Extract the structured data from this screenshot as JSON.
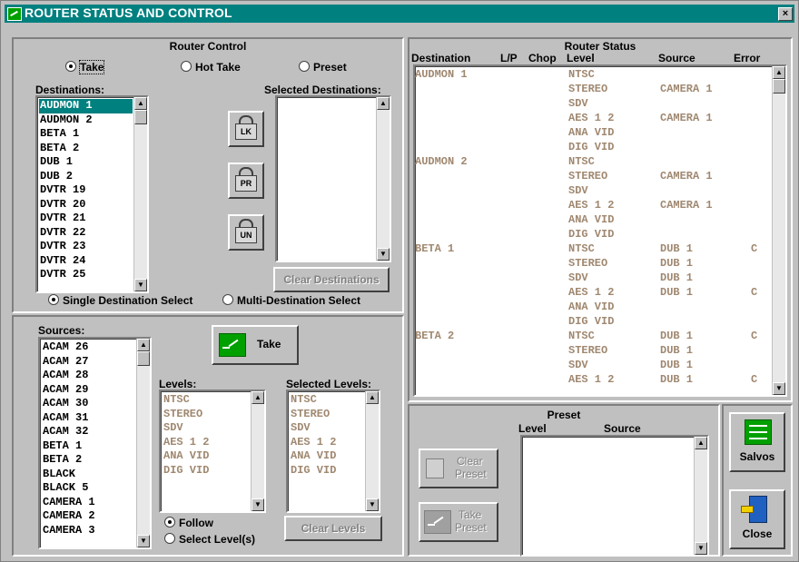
{
  "window": {
    "title": "ROUTER STATUS AND CONTROL",
    "close_glyph": "×"
  },
  "router_control": {
    "title": "Router Control",
    "take_modes": [
      {
        "label": "Take",
        "selected": true
      },
      {
        "label": "Hot Take",
        "selected": false
      },
      {
        "label": "Preset",
        "selected": false
      }
    ],
    "destinations_label": "Destinations:",
    "destinations": [
      "AUDMON 1",
      "AUDMON 2",
      "BETA 1",
      "BETA 2",
      "DUB 1",
      "DUB 2",
      "DVTR 19",
      "DVTR 20",
      "DVTR 21",
      "DVTR 22",
      "DVTR 23",
      "DVTR 24",
      "DVTR 25"
    ],
    "selected_destination_index": 0,
    "selected_destinations_label": "Selected Destinations:",
    "lock_buttons": [
      "LK",
      "PR",
      "UN"
    ],
    "clear_destinations_label": "Clear Destinations",
    "select_modes": [
      {
        "label": "Single Destination Select",
        "selected": true
      },
      {
        "label": "Multi-Destination Select",
        "selected": false
      }
    ]
  },
  "sources_panel": {
    "sources_label": "Sources:",
    "sources": [
      "ACAM 26",
      "ACAM 27",
      "ACAM 28",
      "ACAM 29",
      "ACAM 30",
      "ACAM 31",
      "ACAM 32",
      "BETA 1",
      "BETA 2",
      "BLACK",
      "BLACK 5",
      "CAMERA 1",
      "CAMERA 2",
      "CAMERA 3"
    ],
    "take_label": "Take",
    "levels_label": "Levels:",
    "levels": [
      "NTSC",
      "STEREO",
      "SDV",
      "AES 1 2",
      "ANA VID",
      "DIG VID"
    ],
    "selected_levels_label": "Selected Levels:",
    "selected_levels": [
      "NTSC",
      "STEREO",
      "SDV",
      "AES 1 2",
      "ANA VID",
      "DIG VID"
    ],
    "level_modes": [
      {
        "label": "Follow",
        "selected": true
      },
      {
        "label": "Select Level(s)",
        "selected": false
      }
    ],
    "clear_levels_label": "Clear Levels"
  },
  "router_status": {
    "title": "Router Status",
    "columns": [
      "Destination",
      "L/P",
      "Chop",
      "Level",
      "Source",
      "Error"
    ],
    "rows": [
      {
        "destination": "AUDMON 1",
        "level": "NTSC",
        "source": "",
        "error": ""
      },
      {
        "destination": "",
        "level": "STEREO",
        "source": "CAMERA 1",
        "error": ""
      },
      {
        "destination": "",
        "level": "SDV",
        "source": "",
        "error": ""
      },
      {
        "destination": "",
        "level": "AES 1 2",
        "source": "CAMERA 1",
        "error": ""
      },
      {
        "destination": "",
        "level": "ANA VID",
        "source": "",
        "error": ""
      },
      {
        "destination": "",
        "level": "DIG VID",
        "source": "",
        "error": ""
      },
      {
        "destination": "AUDMON 2",
        "level": "NTSC",
        "source": "",
        "error": ""
      },
      {
        "destination": "",
        "level": "STEREO",
        "source": "CAMERA 1",
        "error": ""
      },
      {
        "destination": "",
        "level": "SDV",
        "source": "",
        "error": ""
      },
      {
        "destination": "",
        "level": "AES 1 2",
        "source": "CAMERA 1",
        "error": ""
      },
      {
        "destination": "",
        "level": "ANA VID",
        "source": "",
        "error": ""
      },
      {
        "destination": "",
        "level": "DIG VID",
        "source": "",
        "error": ""
      },
      {
        "destination": "BETA 1",
        "level": "NTSC",
        "source": "DUB 1",
        "error": "C"
      },
      {
        "destination": "",
        "level": "STEREO",
        "source": "DUB 1",
        "error": ""
      },
      {
        "destination": "",
        "level": "SDV",
        "source": "DUB 1",
        "error": ""
      },
      {
        "destination": "",
        "level": "AES 1 2",
        "source": "DUB 1",
        "error": "C"
      },
      {
        "destination": "",
        "level": "ANA VID",
        "source": "",
        "error": ""
      },
      {
        "destination": "",
        "level": "DIG VID",
        "source": "",
        "error": ""
      },
      {
        "destination": "BETA 2",
        "level": "NTSC",
        "source": "DUB 1",
        "error": "C"
      },
      {
        "destination": "",
        "level": "STEREO",
        "source": "DUB 1",
        "error": ""
      },
      {
        "destination": "",
        "level": "SDV",
        "source": "DUB 1",
        "error": ""
      },
      {
        "destination": "",
        "level": "AES 1 2",
        "source": "DUB 1",
        "error": "C"
      }
    ]
  },
  "preset": {
    "title": "Preset",
    "level_header": "Level",
    "source_header": "Source",
    "clear_preset": [
      "Clear",
      "Preset"
    ],
    "take_preset": [
      "Take",
      "Preset"
    ]
  },
  "side_buttons": {
    "salvos_label": "Salvos",
    "close_label": "Close"
  },
  "colors": {
    "titlebar": "#00807f",
    "selection": "#00807f",
    "dim_text": "#a08870",
    "icon_green": "#00a000"
  }
}
